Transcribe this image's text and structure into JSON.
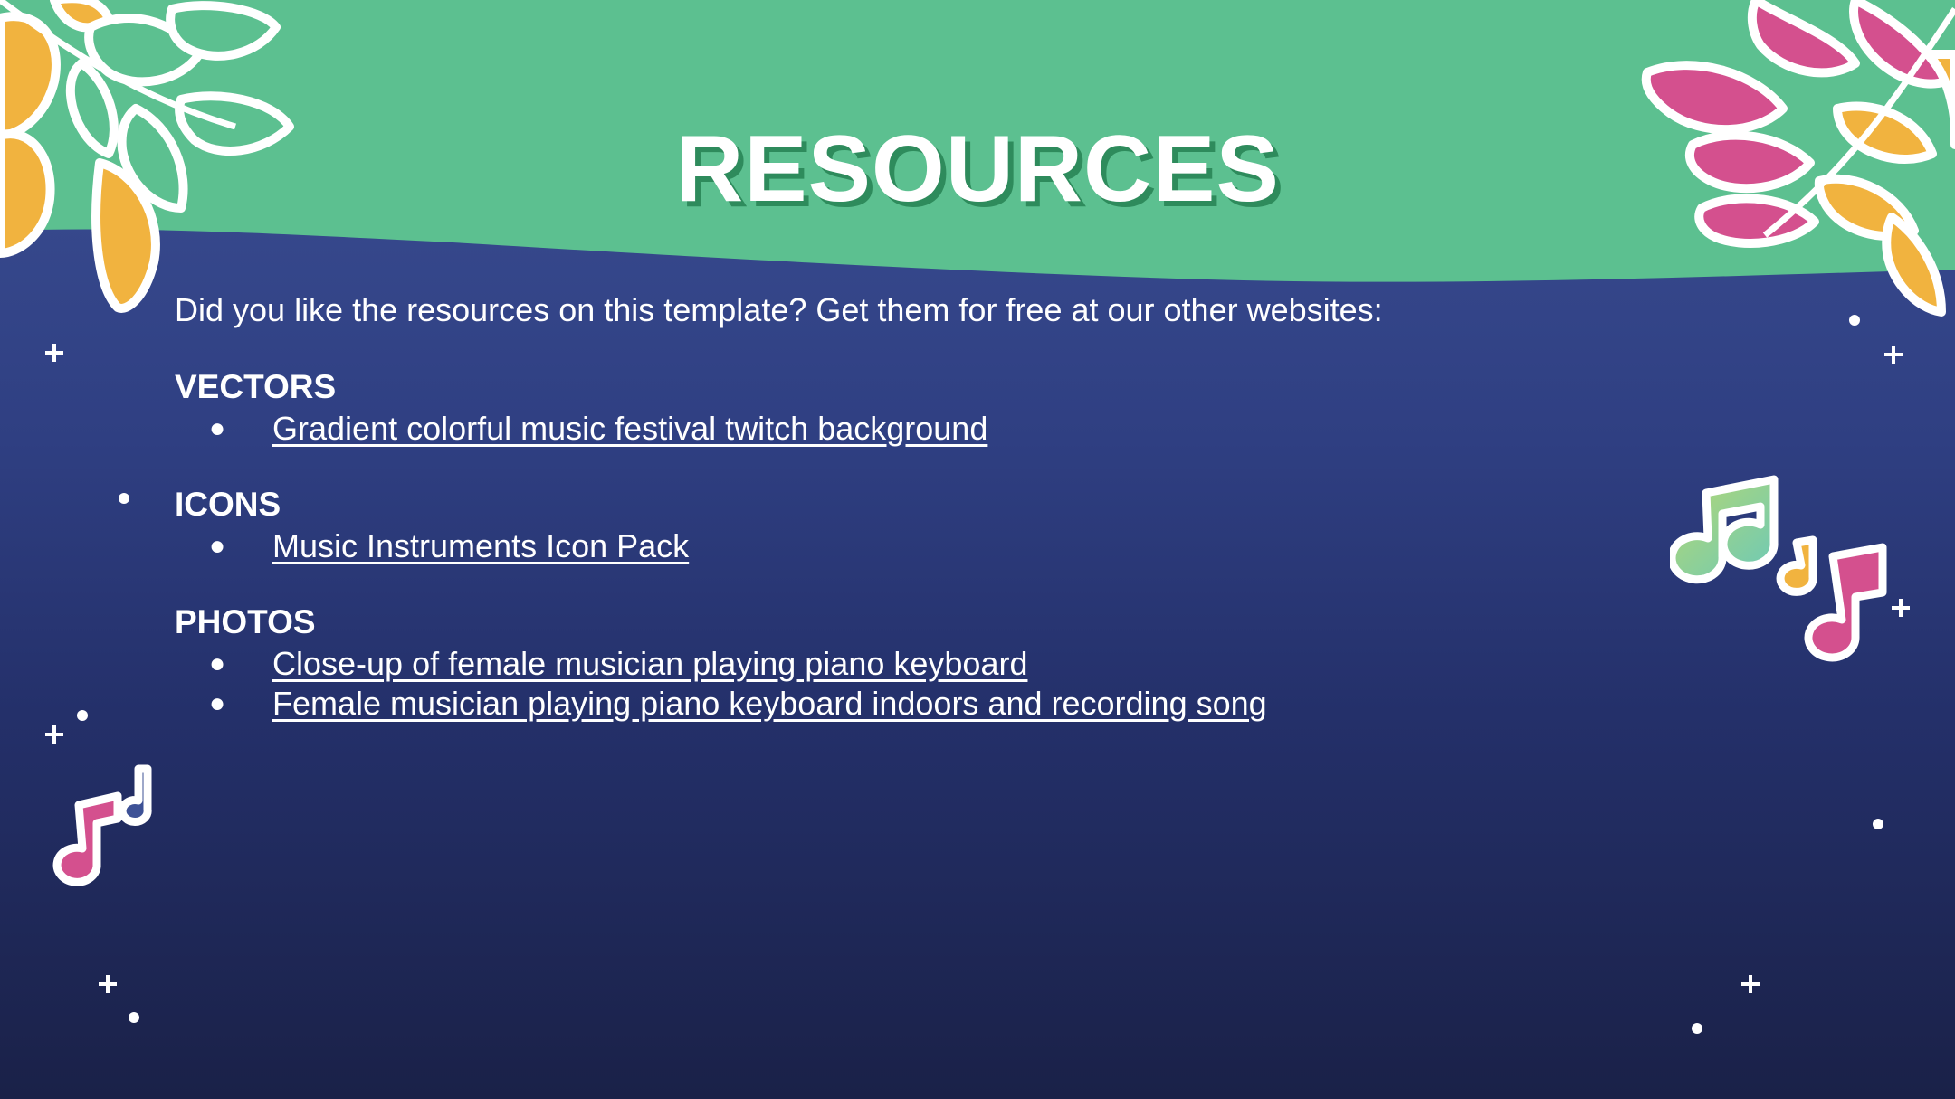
{
  "slide": {
    "title": "RESOURCES",
    "intro": "Did you like the resources on this template? Get them for free at our other websites:",
    "sections": [
      {
        "heading": "VECTORS",
        "links": [
          "Gradient colorful music festival twitch background"
        ]
      },
      {
        "heading": "ICONS",
        "links": [
          "Music Instruments Icon Pack"
        ]
      },
      {
        "heading": "PHOTOS",
        "links": [
          "Close-up of female musician playing piano keyboard",
          "Female musician playing piano keyboard indoors and recording song"
        ]
      }
    ],
    "bullet": "●"
  },
  "colors": {
    "header_green": "#5cc090",
    "background_top": "#3d5196",
    "background_bottom": "#1a2148",
    "leaf_yellow": "#f1b33f",
    "leaf_green": "#5cc090",
    "leaf_pink": "#d4508e",
    "text": "#ffffff"
  },
  "icons": [
    "leaf-cluster-top-left",
    "leaf-cluster-top-right",
    "music-notes-right",
    "music-notes-left",
    "sparkle-plus",
    "sparkle-dot"
  ]
}
